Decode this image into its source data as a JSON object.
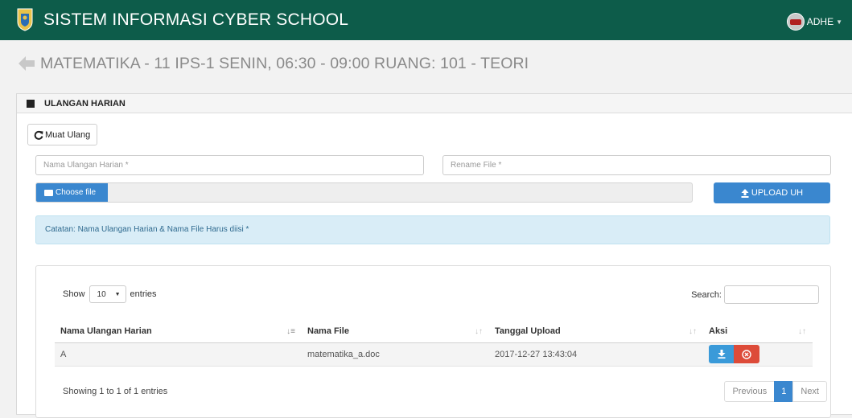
{
  "app": {
    "title": "SISTEM INFORMASI CYBER SCHOOL",
    "user_name": "ADHE"
  },
  "page": {
    "title": "MATEMATIKA - 11 IPS-1 SENIN, 06:30 - 09:00 RUANG: 101 - TEORI"
  },
  "panel": {
    "title": "ULANGAN HARIAN"
  },
  "form": {
    "reload_label": "Muat Ulang",
    "name_placeholder": "Nama Ulangan Harian *",
    "rename_placeholder": "Rename File *",
    "choose_label": "Choose file",
    "upload_label": "UPLOAD UH"
  },
  "alert": {
    "text": "Catatan: Nama Ulangan Harian & Nama File Harus diisi *"
  },
  "table": {
    "show_label": "Show",
    "page_length": "10",
    "entries_label": "entries",
    "search_label": "Search:",
    "columns": [
      "Nama Ulangan Harian",
      "Nama File",
      "Tanggal Upload",
      "Aksi"
    ],
    "rows": [
      {
        "name": "A",
        "file": "matematika_a.doc",
        "date": "2017-12-27 13:43:04"
      }
    ],
    "info": "Showing 1 to 1 of 1 entries",
    "pagination": {
      "previous": "Previous",
      "current": "1",
      "next": "Next"
    }
  },
  "colors": {
    "topbar": "#0d5c4a",
    "primary": "#3a87cf",
    "danger": "#dd4b39",
    "info_bg": "#d9edf7"
  }
}
